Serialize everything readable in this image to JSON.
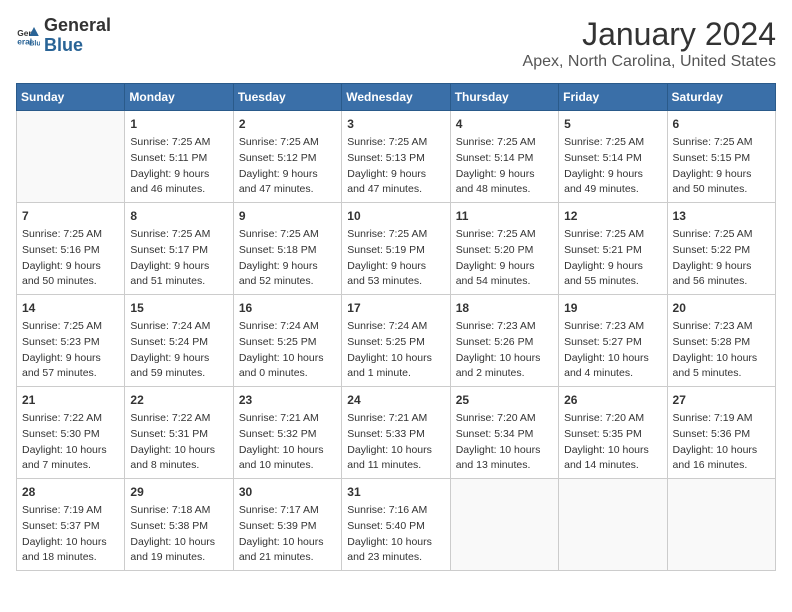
{
  "logo": {
    "line1": "General",
    "line2": "Blue"
  },
  "title": "January 2024",
  "subtitle": "Apex, North Carolina, United States",
  "weekdays": [
    "Sunday",
    "Monday",
    "Tuesday",
    "Wednesday",
    "Thursday",
    "Friday",
    "Saturday"
  ],
  "weeks": [
    [
      {
        "day": "",
        "info": ""
      },
      {
        "day": "1",
        "info": "Sunrise: 7:25 AM\nSunset: 5:11 PM\nDaylight: 9 hours\nand 46 minutes."
      },
      {
        "day": "2",
        "info": "Sunrise: 7:25 AM\nSunset: 5:12 PM\nDaylight: 9 hours\nand 47 minutes."
      },
      {
        "day": "3",
        "info": "Sunrise: 7:25 AM\nSunset: 5:13 PM\nDaylight: 9 hours\nand 47 minutes."
      },
      {
        "day": "4",
        "info": "Sunrise: 7:25 AM\nSunset: 5:14 PM\nDaylight: 9 hours\nand 48 minutes."
      },
      {
        "day": "5",
        "info": "Sunrise: 7:25 AM\nSunset: 5:14 PM\nDaylight: 9 hours\nand 49 minutes."
      },
      {
        "day": "6",
        "info": "Sunrise: 7:25 AM\nSunset: 5:15 PM\nDaylight: 9 hours\nand 50 minutes."
      }
    ],
    [
      {
        "day": "7",
        "info": "Sunrise: 7:25 AM\nSunset: 5:16 PM\nDaylight: 9 hours\nand 50 minutes."
      },
      {
        "day": "8",
        "info": "Sunrise: 7:25 AM\nSunset: 5:17 PM\nDaylight: 9 hours\nand 51 minutes."
      },
      {
        "day": "9",
        "info": "Sunrise: 7:25 AM\nSunset: 5:18 PM\nDaylight: 9 hours\nand 52 minutes."
      },
      {
        "day": "10",
        "info": "Sunrise: 7:25 AM\nSunset: 5:19 PM\nDaylight: 9 hours\nand 53 minutes."
      },
      {
        "day": "11",
        "info": "Sunrise: 7:25 AM\nSunset: 5:20 PM\nDaylight: 9 hours\nand 54 minutes."
      },
      {
        "day": "12",
        "info": "Sunrise: 7:25 AM\nSunset: 5:21 PM\nDaylight: 9 hours\nand 55 minutes."
      },
      {
        "day": "13",
        "info": "Sunrise: 7:25 AM\nSunset: 5:22 PM\nDaylight: 9 hours\nand 56 minutes."
      }
    ],
    [
      {
        "day": "14",
        "info": "Sunrise: 7:25 AM\nSunset: 5:23 PM\nDaylight: 9 hours\nand 57 minutes."
      },
      {
        "day": "15",
        "info": "Sunrise: 7:24 AM\nSunset: 5:24 PM\nDaylight: 9 hours\nand 59 minutes."
      },
      {
        "day": "16",
        "info": "Sunrise: 7:24 AM\nSunset: 5:25 PM\nDaylight: 10 hours\nand 0 minutes."
      },
      {
        "day": "17",
        "info": "Sunrise: 7:24 AM\nSunset: 5:25 PM\nDaylight: 10 hours\nand 1 minute."
      },
      {
        "day": "18",
        "info": "Sunrise: 7:23 AM\nSunset: 5:26 PM\nDaylight: 10 hours\nand 2 minutes."
      },
      {
        "day": "19",
        "info": "Sunrise: 7:23 AM\nSunset: 5:27 PM\nDaylight: 10 hours\nand 4 minutes."
      },
      {
        "day": "20",
        "info": "Sunrise: 7:23 AM\nSunset: 5:28 PM\nDaylight: 10 hours\nand 5 minutes."
      }
    ],
    [
      {
        "day": "21",
        "info": "Sunrise: 7:22 AM\nSunset: 5:30 PM\nDaylight: 10 hours\nand 7 minutes."
      },
      {
        "day": "22",
        "info": "Sunrise: 7:22 AM\nSunset: 5:31 PM\nDaylight: 10 hours\nand 8 minutes."
      },
      {
        "day": "23",
        "info": "Sunrise: 7:21 AM\nSunset: 5:32 PM\nDaylight: 10 hours\nand 10 minutes."
      },
      {
        "day": "24",
        "info": "Sunrise: 7:21 AM\nSunset: 5:33 PM\nDaylight: 10 hours\nand 11 minutes."
      },
      {
        "day": "25",
        "info": "Sunrise: 7:20 AM\nSunset: 5:34 PM\nDaylight: 10 hours\nand 13 minutes."
      },
      {
        "day": "26",
        "info": "Sunrise: 7:20 AM\nSunset: 5:35 PM\nDaylight: 10 hours\nand 14 minutes."
      },
      {
        "day": "27",
        "info": "Sunrise: 7:19 AM\nSunset: 5:36 PM\nDaylight: 10 hours\nand 16 minutes."
      }
    ],
    [
      {
        "day": "28",
        "info": "Sunrise: 7:19 AM\nSunset: 5:37 PM\nDaylight: 10 hours\nand 18 minutes."
      },
      {
        "day": "29",
        "info": "Sunrise: 7:18 AM\nSunset: 5:38 PM\nDaylight: 10 hours\nand 19 minutes."
      },
      {
        "day": "30",
        "info": "Sunrise: 7:17 AM\nSunset: 5:39 PM\nDaylight: 10 hours\nand 21 minutes."
      },
      {
        "day": "31",
        "info": "Sunrise: 7:16 AM\nSunset: 5:40 PM\nDaylight: 10 hours\nand 23 minutes."
      },
      {
        "day": "",
        "info": ""
      },
      {
        "day": "",
        "info": ""
      },
      {
        "day": "",
        "info": ""
      }
    ]
  ]
}
